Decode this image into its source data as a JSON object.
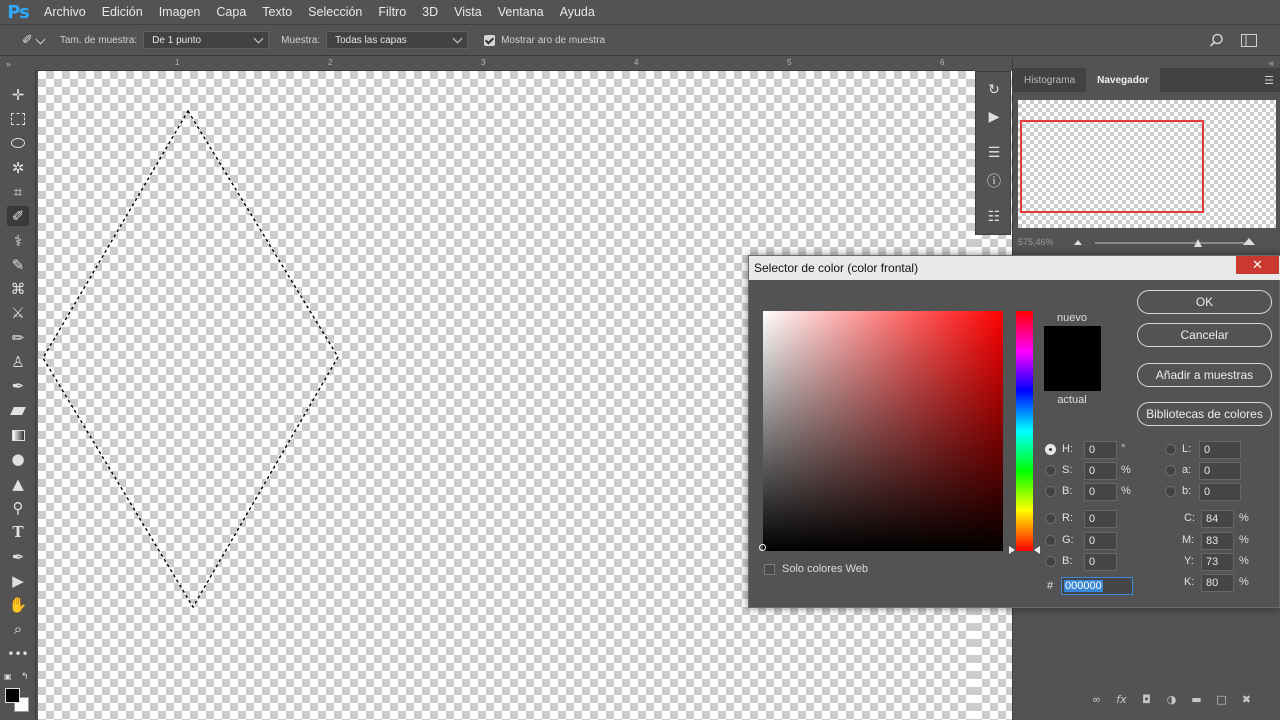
{
  "app": {
    "logo": "Ps"
  },
  "menu": [
    "Archivo",
    "Edición",
    "Imagen",
    "Capa",
    "Texto",
    "Selección",
    "Filtro",
    "3D",
    "Vista",
    "Ventana",
    "Ayuda"
  ],
  "options": {
    "sample_size_label": "Tam. de muestra:",
    "sample_size_value": "De 1 punto",
    "sample_label": "Muestra:",
    "sample_value": "Todas las capas",
    "show_ring_label": "Mostrar aro de muestra"
  },
  "ruler": {
    "labels": [
      "1",
      "2",
      "3",
      "4",
      "5",
      "6"
    ]
  },
  "panel": {
    "tabs": [
      "Histograma",
      "Navegador"
    ],
    "active_tab": "Navegador",
    "zoom": "575,46%"
  },
  "dialog": {
    "title": "Selector de color (color frontal)",
    "new_label": "nuevo",
    "current_label": "actual",
    "buttons": {
      "ok": "OK",
      "cancel": "Cancelar",
      "add_swatch": "Añadir a muestras",
      "libraries": "Bibliotecas de colores"
    },
    "web_only_label": "Solo colores Web",
    "hsb": {
      "h_label": "H:",
      "h": "0",
      "h_unit": "°",
      "s_label": "S:",
      "s": "0",
      "s_unit": "%",
      "b_label": "B:",
      "b": "0",
      "b_unit": "%"
    },
    "lab": {
      "l_label": "L:",
      "l": "0",
      "a_label": "a:",
      "a": "0",
      "b_label": "b:",
      "b": "0"
    },
    "rgb": {
      "r_label": "R:",
      "r": "0",
      "g_label": "G:",
      "g": "0",
      "b_label": "B:",
      "b": "0"
    },
    "cmyk": {
      "c_label": "C:",
      "c": "84",
      "m_label": "M:",
      "m": "83",
      "y_label": "Y:",
      "y": "73",
      "k_label": "K:",
      "k": "80",
      "unit": "%"
    },
    "hex_label": "#",
    "hex": "000000",
    "colors": {
      "new": "#000000",
      "current": "#000000",
      "hue": "#ff0000"
    }
  }
}
